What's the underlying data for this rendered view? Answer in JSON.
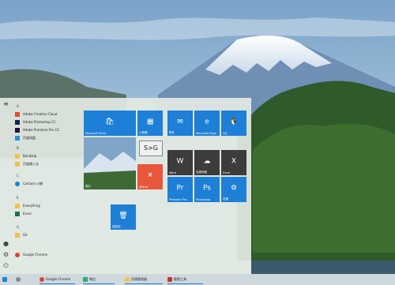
{
  "colors": {
    "accent": "#1e7fd6",
    "tile_dark": "#3c3c3c",
    "menu_bg": "#e2e9e2"
  },
  "rail": {
    "icons": [
      "hamburger-icon",
      "user-icon",
      "settings-icon",
      "power-icon"
    ]
  },
  "app_list": {
    "items": [
      {
        "label": "A",
        "kind": "letter"
      },
      {
        "label": "Adobe Creative Cloud",
        "icon": "adobe-icon"
      },
      {
        "label": "Adobe Photoshop CC",
        "icon": "photoshop-icon"
      },
      {
        "label": "Adobe Premiere Pro CC",
        "icon": "premiere-icon"
      },
      {
        "label": "百度网盘",
        "icon": "cloud-icon"
      },
      {
        "label": "B",
        "kind": "letter"
      },
      {
        "label": "Bandizip",
        "icon": "folder-icon"
      },
      {
        "label": "百度输入法",
        "icon": "folder-icon"
      },
      {
        "label": "C",
        "kind": "letter"
      },
      {
        "label": "Cortana 小娜",
        "icon": "cortana-icon"
      },
      {
        "label": "E",
        "kind": "letter"
      },
      {
        "label": "Everything",
        "icon": "search-icon"
      },
      {
        "label": "Excel",
        "icon": "excel-icon"
      },
      {
        "label": "G",
        "kind": "letter"
      },
      {
        "label": "Git",
        "icon": "folder-icon"
      },
      {
        "label": "Google Chrome",
        "icon": "chrome-icon"
      }
    ]
  },
  "tiles": [
    {
      "label": "Microsoft Store",
      "icon": "store-icon"
    },
    {
      "label": "计算器",
      "icon": "calculator-icon"
    },
    {
      "label": "照片",
      "icon": "photos-icon"
    },
    {
      "label": "S>G",
      "icon": "sg-icon"
    },
    {
      "label": "XMind",
      "icon": "xmind-icon"
    },
    {
      "label": "回收站",
      "icon": "recycle-bin-icon"
    },
    {
      "label": "邮件",
      "icon": "mail-icon"
    },
    {
      "label": "Microsoft Edge",
      "icon": "edge-icon"
    },
    {
      "label": "QQ",
      "icon": "qq-icon"
    },
    {
      "label": "Word",
      "icon": "word-icon"
    },
    {
      "label": "百度网盘",
      "icon": "cloud-icon"
    },
    {
      "label": "Excel",
      "icon": "excel-icon"
    },
    {
      "label": "Premiere Pro",
      "icon": "premiere-icon"
    },
    {
      "label": "Photoshop",
      "icon": "photoshop-icon"
    },
    {
      "label": "设置",
      "icon": "settings-icon"
    }
  ],
  "taskbar": {
    "items": [
      {
        "label": "",
        "icon": "windows-icon"
      },
      {
        "label": "",
        "icon": "search-icon"
      },
      {
        "label": "Google Chrome",
        "icon": "chrome-icon"
      },
      {
        "label": "微信",
        "icon": "wechat-icon"
      },
      {
        "label": "资源管理器",
        "icon": "folder-icon"
      },
      {
        "label": "截图工具",
        "icon": "snip-icon"
      }
    ]
  }
}
